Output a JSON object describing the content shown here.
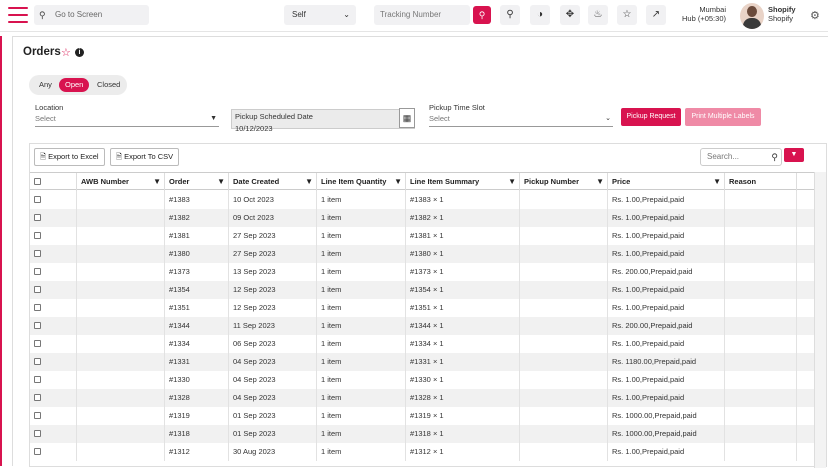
{
  "header": {
    "goto_placeholder": "Go to Screen",
    "self_select": "Self",
    "tracking_placeholder": "Tracking Number",
    "location_city": "Mumbai",
    "location_hub": "Hub (+05:30)",
    "shop_name": "Shopify",
    "shop_sub": "Shopify"
  },
  "page": {
    "title": "Orders",
    "status_tabs": [
      "Any",
      "Open",
      "Closed"
    ],
    "active_tab": "Open"
  },
  "filters": {
    "location_label": "Location",
    "location_value": "Select",
    "pickup_date_label": "Pickup Scheduled Date",
    "pickup_date_value": "10/12/2023",
    "time_slot_label": "Pickup Time Slot",
    "time_slot_value": "Select",
    "pickup_request_btn": "Pickup Request",
    "print_labels_btn": "Print Multiple Labels"
  },
  "grid": {
    "export_excel": "Export to Excel",
    "export_csv": "Export To CSV",
    "search_placeholder": "Search...",
    "columns": [
      "AWB Number",
      "Order",
      "Date Created",
      "Line Item Quantity",
      "Line Item Summary",
      "Pickup Number",
      "Price",
      "Reason"
    ],
    "rows": [
      {
        "awb": "",
        "order": "#1383",
        "date": "10 Oct 2023",
        "qty": "1 item",
        "summary": "#1383 × 1",
        "pickup": "",
        "price": "Rs. 1.00,Prepaid,paid",
        "reason": ""
      },
      {
        "awb": "",
        "order": "#1382",
        "date": "09 Oct 2023",
        "qty": "1 item",
        "summary": "#1382 × 1",
        "pickup": "",
        "price": "Rs. 1.00,Prepaid,paid",
        "reason": ""
      },
      {
        "awb": "",
        "order": "#1381",
        "date": "27 Sep 2023",
        "qty": "1 item",
        "summary": "#1381 × 1",
        "pickup": "",
        "price": "Rs. 1.00,Prepaid,paid",
        "reason": ""
      },
      {
        "awb": "",
        "order": "#1380",
        "date": "27 Sep 2023",
        "qty": "1 item",
        "summary": "#1380 × 1",
        "pickup": "",
        "price": "Rs. 1.00,Prepaid,paid",
        "reason": ""
      },
      {
        "awb": "",
        "order": "#1373",
        "date": "13 Sep 2023",
        "qty": "1 item",
        "summary": "#1373 × 1",
        "pickup": "",
        "price": "Rs. 200.00,Prepaid,paid",
        "reason": ""
      },
      {
        "awb": "",
        "order": "#1354",
        "date": "12 Sep 2023",
        "qty": "1 item",
        "summary": "#1354 × 1",
        "pickup": "",
        "price": "Rs. 1.00,Prepaid,paid",
        "reason": ""
      },
      {
        "awb": "",
        "order": "#1351",
        "date": "12 Sep 2023",
        "qty": "1 item",
        "summary": "#1351 × 1",
        "pickup": "",
        "price": "Rs. 1.00,Prepaid,paid",
        "reason": ""
      },
      {
        "awb": "",
        "order": "#1344",
        "date": "11 Sep 2023",
        "qty": "1 item",
        "summary": "#1344 × 1",
        "pickup": "",
        "price": "Rs. 200.00,Prepaid,paid",
        "reason": ""
      },
      {
        "awb": "",
        "order": "#1334",
        "date": "06 Sep 2023",
        "qty": "1 item",
        "summary": "#1334 × 1",
        "pickup": "",
        "price": "Rs. 1.00,Prepaid,paid",
        "reason": ""
      },
      {
        "awb": "",
        "order": "#1331",
        "date": "04 Sep 2023",
        "qty": "1 item",
        "summary": "#1331 × 1",
        "pickup": "",
        "price": "Rs. 1180.00,Prepaid,paid",
        "reason": ""
      },
      {
        "awb": "",
        "order": "#1330",
        "date": "04 Sep 2023",
        "qty": "1 item",
        "summary": "#1330 × 1",
        "pickup": "",
        "price": "Rs. 1.00,Prepaid,paid",
        "reason": ""
      },
      {
        "awb": "",
        "order": "#1328",
        "date": "04 Sep 2023",
        "qty": "1 item",
        "summary": "#1328 × 1",
        "pickup": "",
        "price": "Rs. 1.00,Prepaid,paid",
        "reason": ""
      },
      {
        "awb": "",
        "order": "#1319",
        "date": "01 Sep 2023",
        "qty": "1 item",
        "summary": "#1319 × 1",
        "pickup": "",
        "price": "Rs. 1000.00,Prepaid,paid",
        "reason": ""
      },
      {
        "awb": "",
        "order": "#1318",
        "date": "01 Sep 2023",
        "qty": "1 item",
        "summary": "#1318 × 1",
        "pickup": "",
        "price": "Rs. 1000.00,Prepaid,paid",
        "reason": ""
      },
      {
        "awb": "",
        "order": "#1312",
        "date": "30 Aug 2023",
        "qty": "1 item",
        "summary": "#1312 × 1",
        "pickup": "",
        "price": "Rs. 1.00,Prepaid,paid",
        "reason": ""
      }
    ]
  },
  "colors": {
    "accent": "#d8134f",
    "accent_light": "#ef8aa6"
  }
}
